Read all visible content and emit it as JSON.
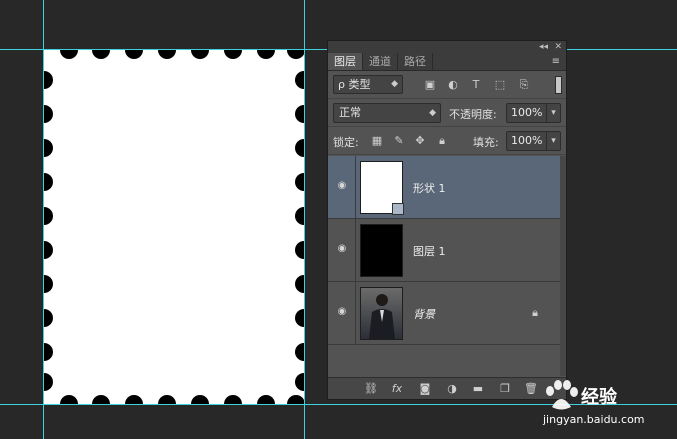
{
  "panel": {
    "header_controls": {
      "collapse": "◂◂",
      "close": "✕"
    },
    "tabs": [
      {
        "label": "图层",
        "active": true
      },
      {
        "label": "通道",
        "active": false
      },
      {
        "label": "路径",
        "active": false
      }
    ],
    "menu_icon": "≡",
    "filter": {
      "label": "ρ 类型",
      "icons": [
        "image-filter-icon",
        "adjustment-filter-icon",
        "type-filter-icon",
        "shape-filter-icon",
        "smartobject-filter-icon"
      ]
    },
    "blend": {
      "mode": "正常",
      "opacity_label": "不透明度:",
      "opacity_value": "100%"
    },
    "locks": {
      "label": "锁定:",
      "fill_label": "填充:",
      "fill_value": "100%"
    },
    "layers": [
      {
        "name": "形状 1",
        "selected": true,
        "visible": true,
        "thumb": "white"
      },
      {
        "name": "图层 1",
        "selected": false,
        "visible": true,
        "thumb": "black"
      },
      {
        "name": "背景",
        "selected": false,
        "visible": true,
        "thumb": "photo",
        "locked": true
      }
    ],
    "bottom_icons": [
      "link-icon",
      "fx-icon",
      "mask-icon",
      "adjustment-icon",
      "folder-icon",
      "new-layer-icon",
      "trash-icon"
    ]
  },
  "watermark": {
    "brand": "经验",
    "url": "jingyan.baidu.com"
  },
  "colors": {
    "guide": "#3fd2de",
    "canvas": "#282828",
    "panel": "#535353",
    "selected_layer": "#596778"
  }
}
